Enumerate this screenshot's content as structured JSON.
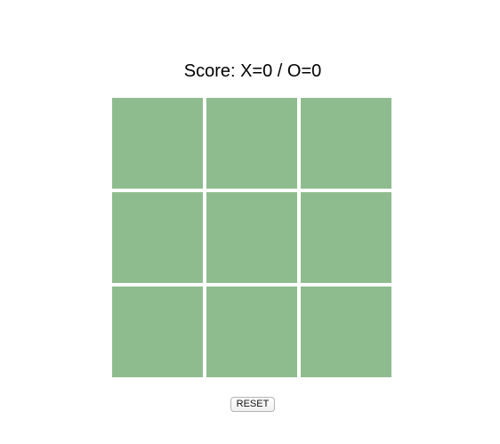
{
  "score": {
    "text": "Score: X=0 / O=0",
    "x": 0,
    "o": 0
  },
  "board": {
    "cells": [
      "",
      "",
      "",
      "",
      "",
      "",
      "",
      "",
      ""
    ],
    "cell_color": "#8fbc8f"
  },
  "controls": {
    "reset_label": "RESET"
  }
}
